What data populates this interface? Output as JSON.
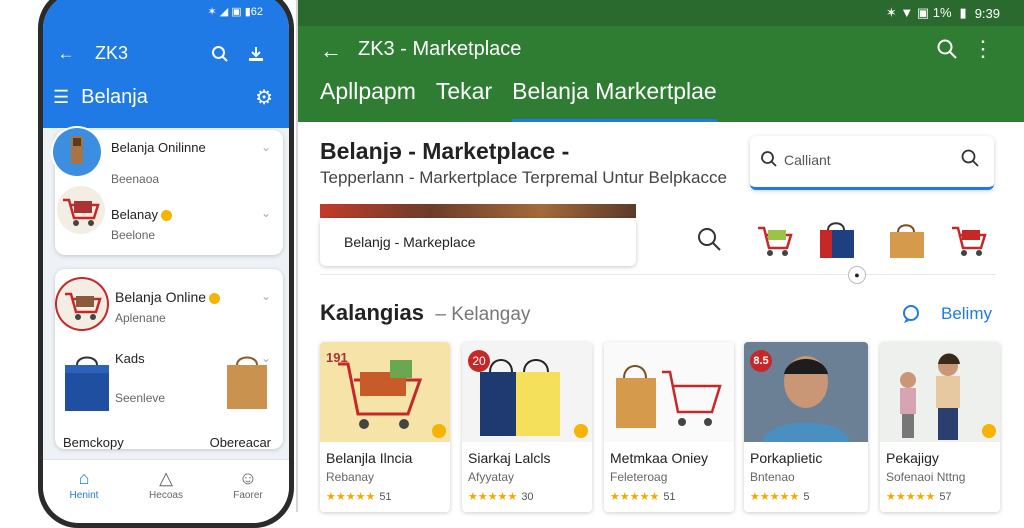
{
  "colors": {
    "phone_header": "#1f7ae6",
    "app_bar": "#2e7d32",
    "accent": "#1f7ae6",
    "star": "#f2a900"
  },
  "phone": {
    "status": "✶ ◢ ▣ ▮62",
    "back_icon": "arrow-left-icon",
    "title": "ZK3",
    "search_icon": "search-icon",
    "download_icon": "download-icon",
    "menu_icon": "menu-icon",
    "section_title": "Belanja",
    "settings_icon": "gear-icon",
    "card1": {
      "item1": "Belanja Onilinne",
      "item1_sub": "Beenaoa",
      "item2": "Belanay",
      "item2_sub": "Beelone"
    },
    "card2": {
      "item1": "Belanja Online",
      "item1_sub": "Aplenane",
      "item2": "Kads",
      "item2_sub": "Seenleve",
      "footer_left": "Bemckopy",
      "footer_right": "Obereacar"
    },
    "nav": [
      {
        "icon": "home-icon",
        "label": "Henint"
      },
      {
        "icon": "bell-icon",
        "label": "Hecoas"
      },
      {
        "icon": "profile-icon",
        "label": "Faorer"
      }
    ]
  },
  "app": {
    "status": {
      "icons": "✶ ▼ ▣ 1%",
      "battery": "▮",
      "time": "9:39"
    },
    "back_icon": "arrow-left-icon",
    "title": "ZK3 - Marketplace",
    "search_icon": "search-icon",
    "more_icon": "more-vert-icon",
    "tabs": [
      "Apllpapm",
      "Tekar",
      "Belanja Markertplae"
    ],
    "active_tab": 2,
    "heading": "Belanjə - Marketplace -",
    "subheading": "Tepperlann - Markertplace Terpremal Untur Belpkacce",
    "search": {
      "placeholder": "Calliant"
    },
    "banner_card": "Belanjg - Markeplace",
    "section": {
      "title": "Kalangias",
      "sub": "Kelangay",
      "action": "Belimy"
    },
    "products": [
      {
        "badge": "191",
        "title": "Belanjla Ilncia",
        "sub": "Rebanay",
        "stars": "★★★★★",
        "rating": "51"
      },
      {
        "badge": "20",
        "title": "Siarkaj Lalcls",
        "sub": "Afyyatay",
        "stars": "★★★★★",
        "rating": "30"
      },
      {
        "badge": "",
        "title": "Metmkaa Oniey",
        "sub": "Feleteroag",
        "stars": "★★★★★",
        "rating": "51"
      },
      {
        "badge": "8.5",
        "title": "Porkaplietic",
        "sub": "Bntenao",
        "stars": "★★★★★",
        "rating": "5"
      },
      {
        "badge": "",
        "title": "Pekajigy",
        "sub": "Sofenaoi Nttng",
        "stars": "★★★★★",
        "rating": "57"
      }
    ]
  }
}
